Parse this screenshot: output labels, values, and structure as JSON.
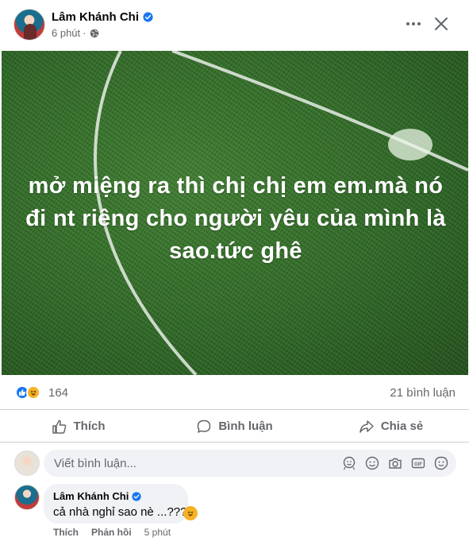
{
  "post": {
    "author": "Lâm Khánh Chi",
    "time": "6 phút",
    "image_text": "mở miệng ra thì chị chị em em.mà nó đi nt riêng cho người yêu của mình là sao.tức ghê",
    "reaction_count": "164",
    "comments_count": "21 bình luận"
  },
  "actions": {
    "like": "Thích",
    "comment": "Bình luận",
    "share": "Chia sẻ"
  },
  "comment_input": {
    "placeholder": "Viết bình luận..."
  },
  "comment": {
    "author": "Lâm Khánh Chi",
    "text": "cả nhà nghỉ sao nè ...???",
    "like": "Thích",
    "reply": "Phản hồi",
    "time": "5 phút"
  },
  "icons": {
    "more": "more-horizontal-icon",
    "close": "close-icon",
    "privacy": "globe-icon",
    "verified": "verified-badge-icon"
  },
  "colors": {
    "brand": "#1877f2",
    "secondary_text": "#65676b",
    "grass": "#2f6b25",
    "haha": "#f7b125"
  }
}
